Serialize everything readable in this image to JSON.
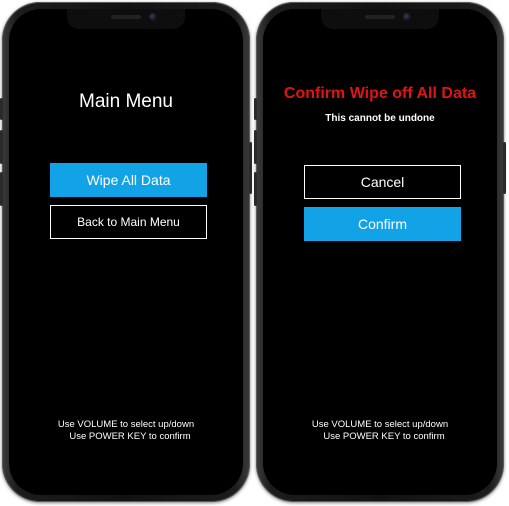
{
  "screens": [
    {
      "title": "Main Menu",
      "buttons": [
        {
          "label": "Wipe All Data",
          "selected": true
        },
        {
          "label": "Back to Main Menu",
          "selected": false
        }
      ],
      "hint_line1": "Use VOLUME to select up/down",
      "hint_line2": "Use POWER KEY to confirm"
    },
    {
      "title": "Confirm Wipe off All Data",
      "subtitle": "This cannot be undone",
      "buttons": [
        {
          "label": "Cancel",
          "selected": false
        },
        {
          "label": "Confirm",
          "selected": true
        }
      ],
      "hint_line1": "Use VOLUME to select up/down",
      "hint_line2": "Use POWER KEY to confirm"
    }
  ],
  "colors": {
    "selected_button": "#12a3e6",
    "warning_title": "#e01414",
    "screen_background": "#000000"
  }
}
